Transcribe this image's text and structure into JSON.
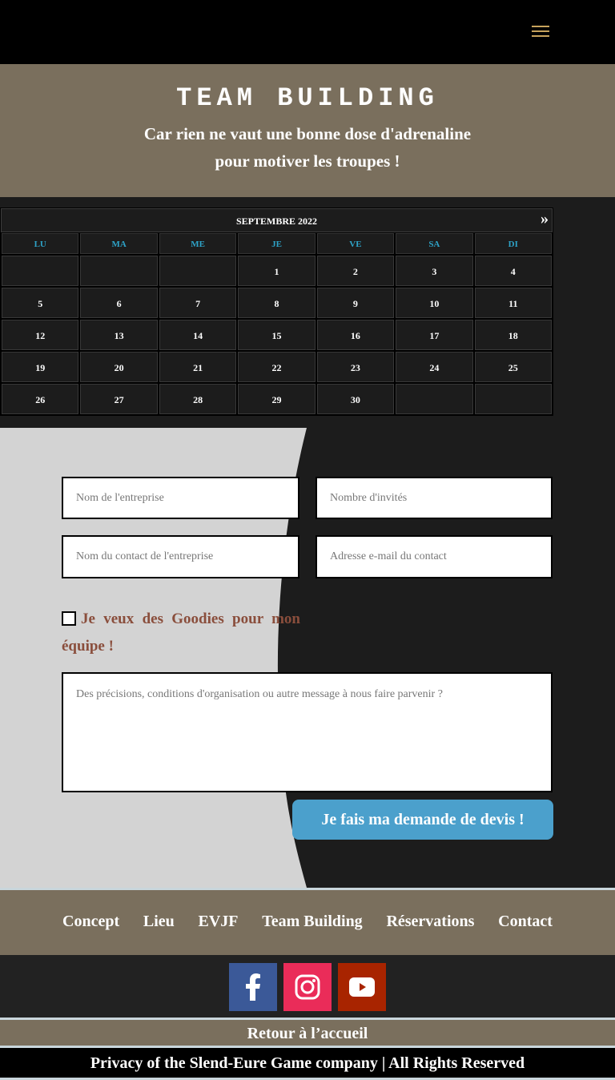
{
  "header": {
    "menu_icon": "hamburger-menu-icon",
    "accent": "#c7a35c"
  },
  "hero": {
    "title": "TEAM BUILDING",
    "subtitle_line1": "Car rien ne vaut une bonne dose d'adrenaline",
    "subtitle_line2": "pour motiver les troupes !"
  },
  "calendar": {
    "month": "SEPTEMBRE 2022",
    "next": "»",
    "weekdays": [
      "LU",
      "MA",
      "ME",
      "JE",
      "VE",
      "SA",
      "DI"
    ],
    "weeks": [
      [
        "",
        "",
        "",
        "1",
        "2",
        "3",
        "4"
      ],
      [
        "5",
        "6",
        "7",
        "8",
        "9",
        "10",
        "11"
      ],
      [
        "12",
        "13",
        "14",
        "15",
        "16",
        "17",
        "18"
      ],
      [
        "19",
        "20",
        "21",
        "22",
        "23",
        "24",
        "25"
      ],
      [
        "26",
        "27",
        "28",
        "29",
        "30",
        "",
        ""
      ]
    ]
  },
  "form": {
    "company_placeholder": "Nom de l'entreprise",
    "guests_placeholder": "Nombre d'invités",
    "contact_placeholder": "Nom du contact de l'entreprise",
    "email_placeholder": "Adresse e-mail du contact",
    "goodies_label": "Je veux des Goodies pour mon équipe !",
    "message_placeholder": "Des précisions, conditions d'organisation ou autre message à nous faire parvenir ?",
    "submit_label": "Je fais ma demande de devis !"
  },
  "footer_nav": [
    "Concept",
    "Lieu",
    "EVJF",
    "Team Building",
    "Réservations",
    "Contact"
  ],
  "social": [
    {
      "icon": "facebook-icon",
      "color": "#3b5998"
    },
    {
      "icon": "instagram-icon",
      "color": "#ea2c59"
    },
    {
      "icon": "youtube-icon",
      "color": "#a82400"
    }
  ],
  "back_home": "Retour à l’accueil",
  "copyright": "Privacy of the Slend-Eure Game company  | All Rights Reserved"
}
